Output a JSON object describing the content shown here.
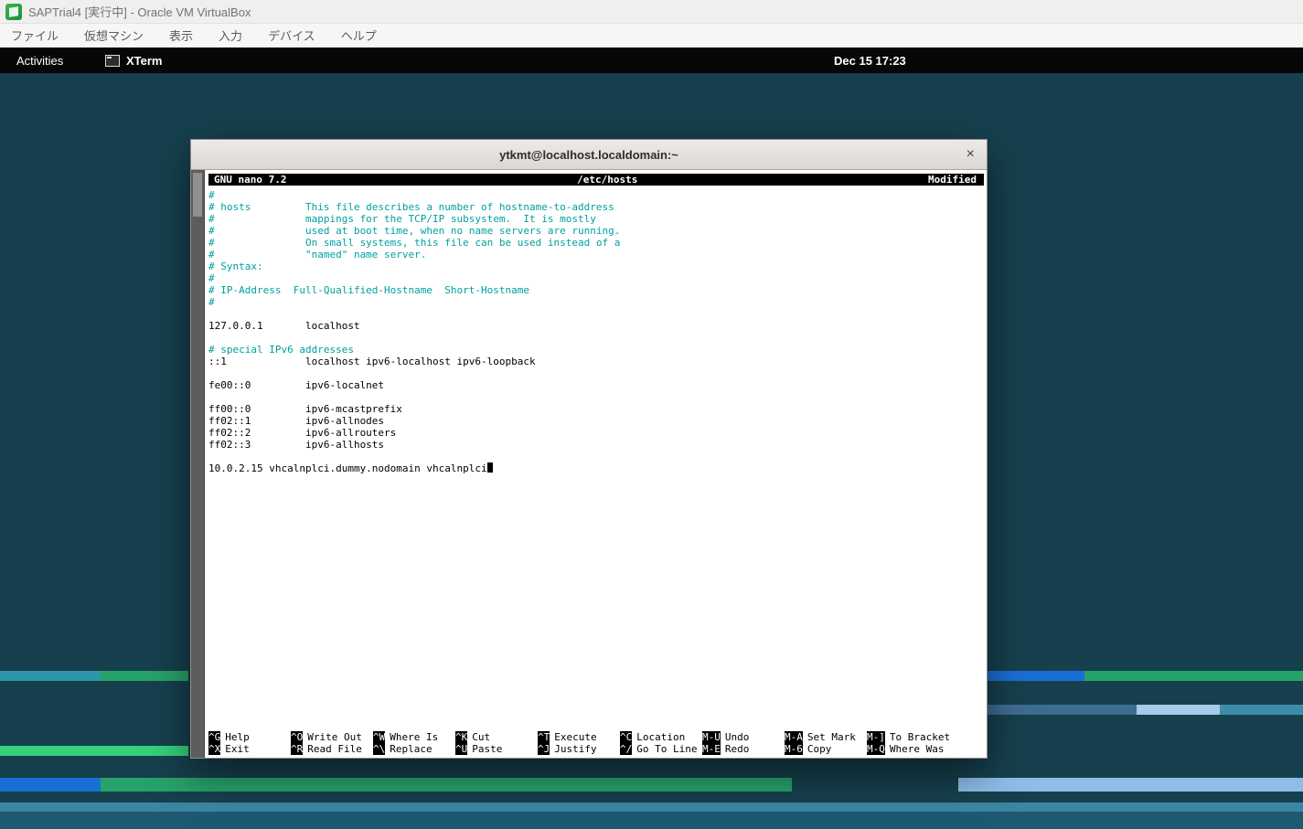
{
  "vbox": {
    "title": "SAPTrial4 [実行中] - Oracle VM VirtualBox",
    "menu": [
      "ファイル",
      "仮想マシン",
      "表示",
      "入力",
      "デバイス",
      "ヘルプ"
    ]
  },
  "topbar": {
    "activities": "Activities",
    "app": "XTerm",
    "clock": "Dec 15  17:23"
  },
  "colors": {
    "comment_text": "#00a0a0",
    "desktop_background": "#16404e",
    "stripe_green": "#27a268",
    "stripe_blue": "#1a6fd6",
    "stripe_light_blue": "#8fbde9"
  },
  "terminal": {
    "title": "ytkmt@localhost.localdomain:~",
    "close": "×",
    "nano": {
      "header_left": "GNU nano 7.2",
      "header_center": "/etc/hosts",
      "header_right": "Modified",
      "lines": [
        {
          "text": "#",
          "type": "comment"
        },
        {
          "text": "# hosts         This file describes a number of hostname-to-address",
          "type": "comment"
        },
        {
          "text": "#               mappings for the TCP/IP subsystem.  It is mostly",
          "type": "comment"
        },
        {
          "text": "#               used at boot time, when no name servers are running.",
          "type": "comment"
        },
        {
          "text": "#               On small systems, this file can be used instead of a",
          "type": "comment"
        },
        {
          "text": "#               \"named\" name server.",
          "type": "comment"
        },
        {
          "text": "# Syntax:",
          "type": "comment"
        },
        {
          "text": "#",
          "type": "comment"
        },
        {
          "text": "# IP-Address  Full-Qualified-Hostname  Short-Hostname",
          "type": "comment"
        },
        {
          "text": "#",
          "type": "comment"
        },
        {
          "text": "",
          "type": "plain"
        },
        {
          "text": "127.0.0.1       localhost",
          "type": "plain"
        },
        {
          "text": "",
          "type": "plain"
        },
        {
          "text": "# special IPv6 addresses",
          "type": "comment"
        },
        {
          "text": "::1             localhost ipv6-localhost ipv6-loopback",
          "type": "plain"
        },
        {
          "text": "",
          "type": "plain"
        },
        {
          "text": "fe00::0         ipv6-localnet",
          "type": "plain"
        },
        {
          "text": "",
          "type": "plain"
        },
        {
          "text": "ff00::0         ipv6-mcastprefix",
          "type": "plain"
        },
        {
          "text": "ff02::1         ipv6-allnodes",
          "type": "plain"
        },
        {
          "text": "ff02::2         ipv6-allrouters",
          "type": "plain"
        },
        {
          "text": "ff02::3         ipv6-allhosts",
          "type": "plain"
        },
        {
          "text": "",
          "type": "plain"
        },
        {
          "text": "10.0.2.15 vhcalnplci.dummy.nodomain vhcalnplci",
          "type": "plain",
          "cursor": true
        }
      ],
      "shortcut_rows": [
        [
          {
            "key": "^G",
            "label": "Help"
          },
          {
            "key": "^O",
            "label": "Write Out"
          },
          {
            "key": "^W",
            "label": "Where Is"
          },
          {
            "key": "^K",
            "label": "Cut"
          },
          {
            "key": "^T",
            "label": "Execute"
          },
          {
            "key": "^C",
            "label": "Location"
          },
          {
            "key": "M-U",
            "label": "Undo"
          },
          {
            "key": "M-A",
            "label": "Set Mark"
          },
          {
            "key": "M-]",
            "label": "To Bracket"
          }
        ],
        [
          {
            "key": "^X",
            "label": "Exit"
          },
          {
            "key": "^R",
            "label": "Read File"
          },
          {
            "key": "^\\",
            "label": "Replace"
          },
          {
            "key": "^U",
            "label": "Paste"
          },
          {
            "key": "^J",
            "label": "Justify"
          },
          {
            "key": "^/",
            "label": "Go To Line"
          },
          {
            "key": "M-E",
            "label": "Redo"
          },
          {
            "key": "M-6",
            "label": "Copy"
          },
          {
            "key": "M-Q",
            "label": "Where Was"
          }
        ]
      ]
    }
  }
}
